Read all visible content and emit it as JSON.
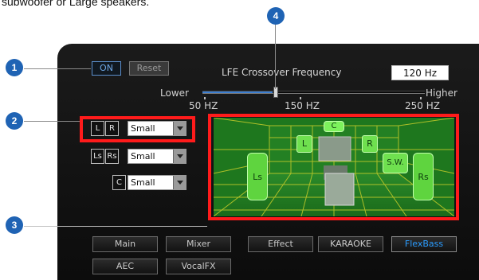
{
  "intro_text": "subwoofer or Large speakers.",
  "controls": {
    "on_label": "ON",
    "reset_label": "Reset"
  },
  "lfe": {
    "title": "LFE Crossover Frequency",
    "value": "120 Hz",
    "lower_label": "Lower",
    "higher_label": "Higher",
    "ticks": [
      "50 HZ",
      "150 HZ",
      "250 HZ"
    ],
    "slider_position_percent": 32
  },
  "speakers": {
    "front": {
      "left": "L",
      "right": "R",
      "size": "Small"
    },
    "surround": {
      "left": "Ls",
      "right": "Rs",
      "size": "Small"
    },
    "center": {
      "label": "C",
      "size": "Small"
    }
  },
  "viz_labels": {
    "C": "C",
    "L": "L",
    "R": "R",
    "SW": "S.W.",
    "Ls": "Ls",
    "Rs": "Rs"
  },
  "tabs": {
    "row1": [
      "Main",
      "Mixer",
      "Effect",
      "KARAOKE",
      "FlexBass"
    ],
    "row2": [
      "AEC",
      "VocalFX"
    ],
    "active": "FlexBass"
  },
  "callouts": [
    "1",
    "2",
    "3",
    "4"
  ],
  "colors": {
    "highlight_red": "#ff1b1b",
    "badge_blue": "#1f63b4",
    "active_tab_blue": "#2a9cff",
    "slider_blue": "#3d7fd0",
    "room_green": "#1f7a1f"
  }
}
